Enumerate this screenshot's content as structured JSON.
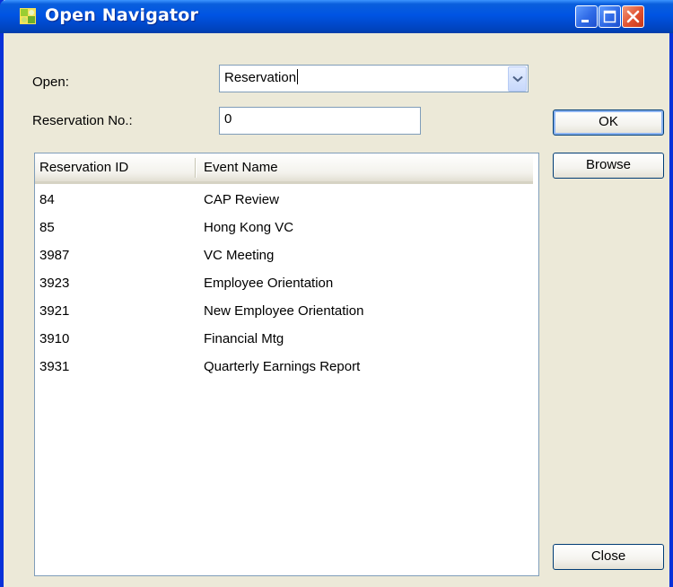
{
  "window": {
    "title": "Open Navigator"
  },
  "form": {
    "open_label": "Open:",
    "open_value": "Reservation",
    "reservation_no_label": "Reservation No.:",
    "reservation_no_value": "0"
  },
  "buttons": {
    "ok": "OK",
    "browse": "Browse",
    "close": "Close"
  },
  "list": {
    "columns": [
      "Reservation ID",
      "Event Name"
    ],
    "rows": [
      {
        "id": "84",
        "name": "CAP Review"
      },
      {
        "id": "85",
        "name": "Hong Kong VC"
      },
      {
        "id": "3987",
        "name": "VC Meeting"
      },
      {
        "id": "3923",
        "name": "Employee Orientation"
      },
      {
        "id": "3921",
        "name": "New Employee Orientation"
      },
      {
        "id": "3910",
        "name": "Financial Mtg"
      },
      {
        "id": "3931",
        "name": "Quarterly Earnings Report"
      }
    ]
  },
  "icons": {
    "title": "navigator-app-icon",
    "minimize": "minimize-icon",
    "maximize": "maximize-icon",
    "close": "close-icon",
    "dropdown": "chevron-down-icon"
  },
  "colors": {
    "titlebar": "#0054E3",
    "window_bg": "#ECE9D8",
    "close_button": "#E1502F"
  }
}
